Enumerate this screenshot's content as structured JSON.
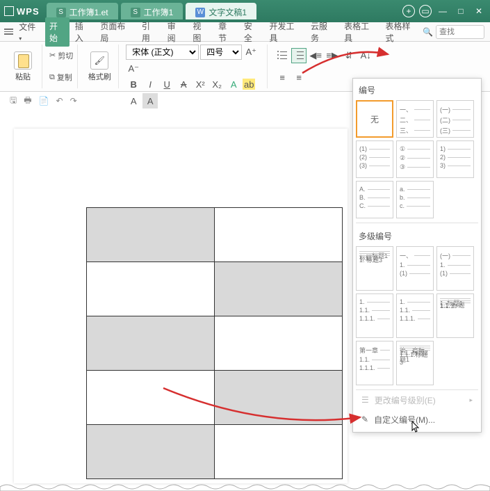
{
  "app": {
    "name": "WPS"
  },
  "tabs": [
    {
      "icon": "S",
      "label": "工作簿1.et"
    },
    {
      "icon": "S",
      "label": "工作簿1"
    },
    {
      "icon": "W",
      "label": "文字文稿1",
      "active": true
    }
  ],
  "menubar": {
    "file": "文件",
    "items": [
      "开始",
      "插入",
      "页面布局",
      "引用",
      "审阅",
      "视图",
      "章节",
      "安全",
      "开发工具",
      "云服务",
      "表格工具",
      "表格样式"
    ],
    "search_placeholder": "查找"
  },
  "ribbon": {
    "paste": "粘贴",
    "cut": "剪切",
    "copy": "复制",
    "fmt": "格式刷",
    "font": "宋体 (正文)",
    "size": "四号"
  },
  "numbering": {
    "title": "编号",
    "none": "无",
    "sec2": "多级编号",
    "change_level": "更改编号级别(E)",
    "custom": "自定义编号(M)...",
    "r1": [
      [
        "一、",
        "二、",
        "三、"
      ],
      [
        "(一)",
        "(二)",
        "(三)"
      ]
    ],
    "r2": [
      [
        "(1)",
        "(2)",
        "(3)"
      ],
      [
        "①",
        "②",
        "③"
      ],
      [
        "1)",
        "2)",
        "3)"
      ]
    ],
    "r3": [
      [
        "A.",
        "B.",
        "C."
      ],
      [
        "a.",
        "b.",
        "c."
      ]
    ],
    "m1": [
      [
        "一、标题1",
        " 标题 2",
        "  1. 标题3"
      ],
      [
        "一、",
        "1.",
        "(1)"
      ],
      [
        "(一)",
        "1.",
        "(1)"
      ]
    ],
    "m2": [
      [
        "1.",
        "1.1.",
        "1.1.1."
      ],
      [
        "1.",
        "1.1.",
        "1.1.1."
      ],
      [
        "1. 标题1",
        "1.1. 标题",
        "1.1.1."
      ]
    ],
    "m3": [
      [
        "第一章",
        "1.1.",
        "1.1.1."
      ],
      [
        "第一章标题1",
        "1.1. 标题2",
        "1.1.1.标题3"
      ]
    ]
  }
}
